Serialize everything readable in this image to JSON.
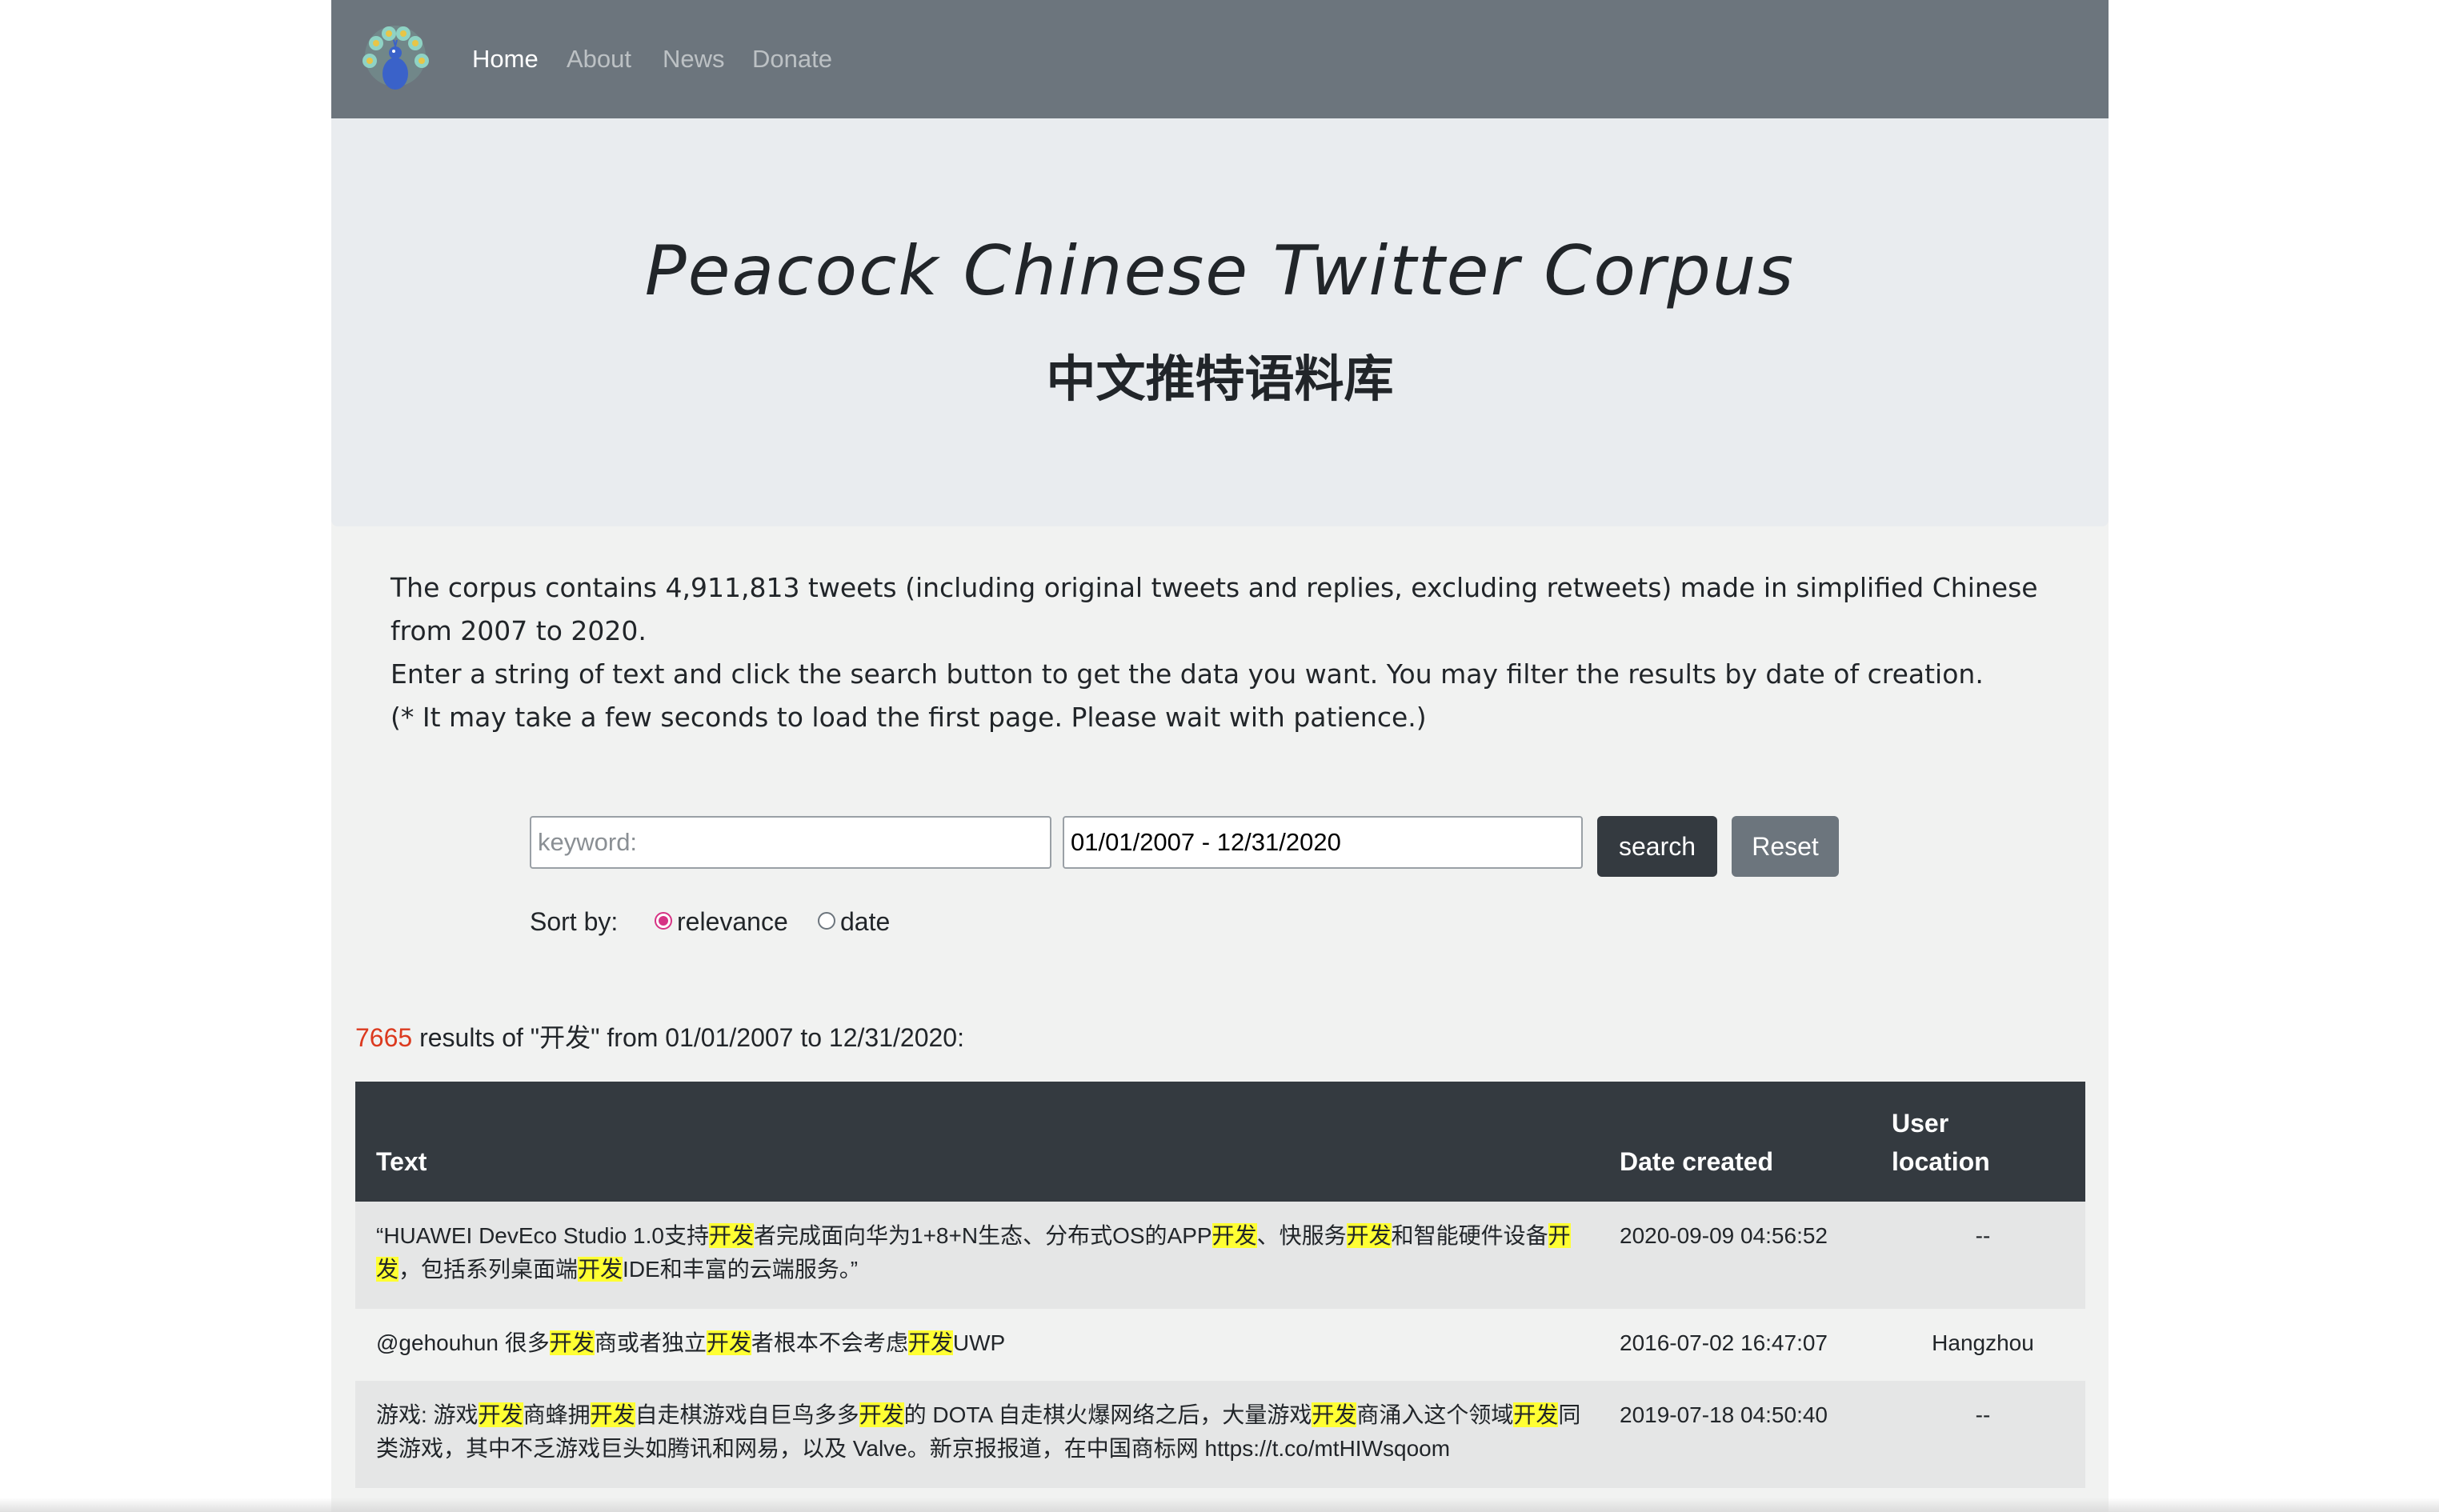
{
  "navbar": {
    "logo_icon": "peacock-logo-icon",
    "links": [
      {
        "label": "Home",
        "active": true
      },
      {
        "label": "About",
        "active": false
      },
      {
        "label": "News",
        "active": false
      },
      {
        "label": "Donate",
        "active": false
      }
    ]
  },
  "header": {
    "title_en": "Peacock Chinese Twitter Corpus",
    "title_zh": "中文推特语料库"
  },
  "intro": {
    "line1": "The corpus contains 4,911,813 tweets (including original tweets and replies, excluding retweets) made in simplified Chinese from 2007 to 2020.",
    "line2": "Enter a string of text and click the search button to get the data you want. You may filter the results by date of creation.",
    "line3": "(* It may take a few seconds to load the first page. Please wait with patience.)"
  },
  "search": {
    "keyword_placeholder": "keyword:",
    "keyword_value": "",
    "daterange_value": "01/01/2007 - 12/31/2020",
    "search_label": "search",
    "reset_label": "Reset",
    "sort_label": "Sort by:",
    "sort_options": [
      {
        "label": "relevance",
        "checked": true
      },
      {
        "label": "date",
        "checked": false
      }
    ]
  },
  "results": {
    "count": "7665",
    "summary_text": " results of \"开发\" from 01/01/2007 to 12/31/2020:",
    "highlight_term": "开发",
    "columns": [
      "Text",
      "Date created",
      "User location"
    ],
    "rows": [
      {
        "text": "“HUAWEI DevEco Studio 1.0支持开发者完成面向华为1+8+N生态、分布式OS的APP开发、快服务开发和智能硬件设备开发，包括系列桌面端开发IDE和丰富的云端服务。”",
        "date": "2020-09-09 04:56:52",
        "location": "--"
      },
      {
        "text": "@gehouhun 很多开发商或者独立开发者根本不会考虑开发UWP",
        "date": "2016-07-02 16:47:07",
        "location": "Hangzhou"
      },
      {
        "text": "游戏: 游戏开发商蜂拥开发自走棋游戏自巨鸟多多开发的 DOTA 自走棋火爆网络之后，大量游戏开发商涌入这个领域开发同类游戏，其中不乏游戏巨头如腾讯和网易，以及 Valve。新京报报道，在中国商标网 https://t.co/mtHIWsqoom",
        "date": "2019-07-18 04:50:40",
        "location": "--"
      }
    ]
  },
  "colors": {
    "navbar_bg": "#6c757d",
    "jumbotron_bg": "#e9ecef",
    "table_header_bg": "#343a40",
    "highlight": "#ffff33",
    "count_color": "#dc3a1f",
    "radio_accent": "#d63384"
  }
}
